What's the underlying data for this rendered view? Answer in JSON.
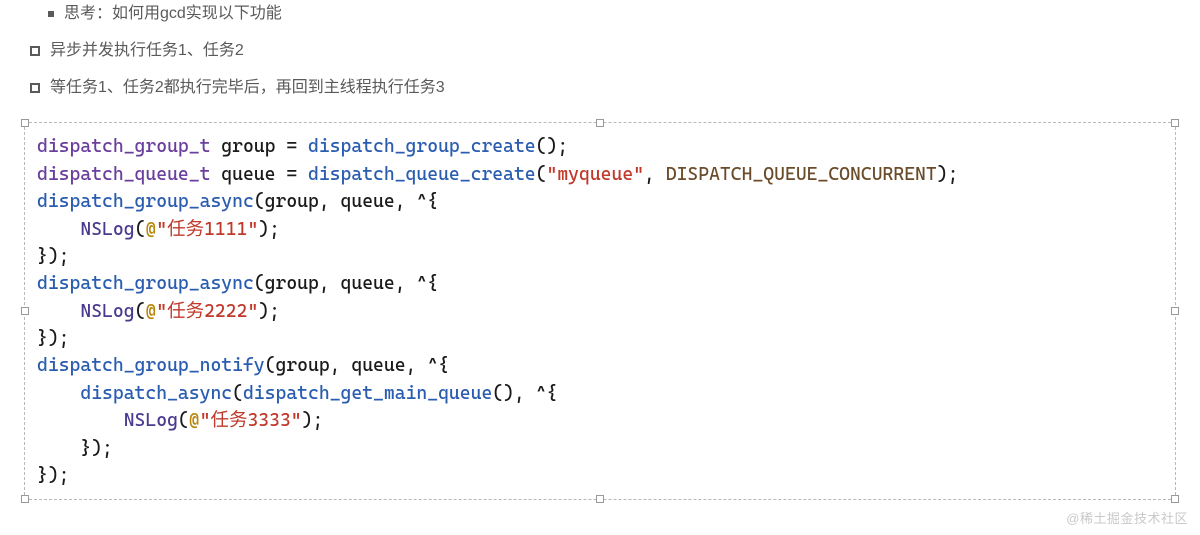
{
  "bullets": {
    "item0": "思考：如何用gcd实现以下功能",
    "item1": "异步并发执行任务1、任务2",
    "item2": "等任务1、任务2都执行完毕后，再回到主线程执行任务3"
  },
  "code": {
    "line1": {
      "t1": "dispatch_group_t",
      "p1": " group = ",
      "f1": "dispatch_group_create",
      "p2": "();"
    },
    "line2": {
      "t1": "dispatch_queue_t",
      "p1": " queue = ",
      "f1": "dispatch_queue_create",
      "p2": "(",
      "s1": "\"myqueue\"",
      "p3": ", ",
      "c1": "DISPATCH_QUEUE_CONCURRENT",
      "p4": ");"
    },
    "line3": {
      "f1": "dispatch_group_async",
      "p1": "(group, queue, ^{"
    },
    "line4": {
      "indent": "    ",
      "n1": "NSLog",
      "p1": "(",
      "a1": "@",
      "s1": "\"任务1111\"",
      "p2": ");"
    },
    "line5": {
      "p1": "});"
    },
    "line6": {
      "f1": "dispatch_group_async",
      "p1": "(group, queue, ^{"
    },
    "line7": {
      "indent": "    ",
      "n1": "NSLog",
      "p1": "(",
      "a1": "@",
      "s1": "\"任务2222\"",
      "p2": ");"
    },
    "line8": {
      "p1": "});"
    },
    "line9": {
      "f1": "dispatch_group_notify",
      "p1": "(group, queue, ^{"
    },
    "line10": {
      "indent": "    ",
      "f1": "dispatch_async",
      "p1": "(",
      "f2": "dispatch_get_main_queue",
      "p2": "(), ^{"
    },
    "line11": {
      "indent": "        ",
      "n1": "NSLog",
      "p1": "(",
      "a1": "@",
      "s1": "\"任务3333\"",
      "p2": ");"
    },
    "line12": {
      "indent": "    ",
      "p1": "});"
    },
    "line13": {
      "p1": "});"
    }
  },
  "watermark": "@稀土掘金技术社区"
}
